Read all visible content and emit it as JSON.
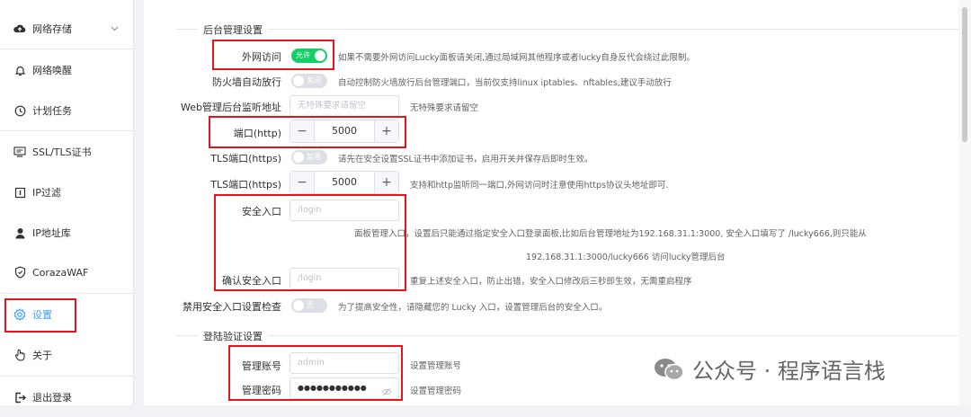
{
  "sidebar": {
    "items": [
      {
        "label": "网络存储",
        "icon": "cloud-icon"
      },
      {
        "label": "网络唤醒",
        "icon": "bell-icon"
      },
      {
        "label": "计划任务",
        "icon": "clock-icon"
      },
      {
        "label": "SSL/TLS证书",
        "icon": "certificate-icon"
      },
      {
        "label": "IP过滤",
        "icon": "filter-icon"
      },
      {
        "label": "IP地址库",
        "icon": "user-icon"
      },
      {
        "label": "CorazaWAF",
        "icon": "shield-icon"
      },
      {
        "label": "设置",
        "icon": "gear-icon"
      },
      {
        "label": "关于",
        "icon": "pointer-icon"
      },
      {
        "label": "退出登录",
        "icon": "logout-icon"
      }
    ],
    "active": "设置"
  },
  "backend": {
    "section_title": "后台管理设置",
    "wan_access": {
      "label": "外网访问",
      "switch": "允许",
      "hint": "如果不需要外网访问Lucky面板请关闭,通过局域网其他程序或者lucky自身反代会绕过此限制。"
    },
    "firewall": {
      "label": "防火墙自动放行",
      "switch": "关闭",
      "hint": "自动控制防火墙放行后台管理端口，当前仅支持linux iptables、nftables,建议手动放行"
    },
    "web_listen": {
      "label": "Web管理后台监听地址",
      "placeholder": "无特殊要求请留空",
      "hint": "无特殊要求请留空"
    },
    "http_port": {
      "label": "端口(http)",
      "value": "5000",
      "minus": "−",
      "plus": "+"
    },
    "tls_port_switch": {
      "label": "TLS端口(https)",
      "switch": "禁用",
      "hint": "请先在安全设置SSL证书中添加证书，启用开关并保存后即时生效。"
    },
    "tls_port": {
      "label": "TLS端口(https)",
      "value": "5000",
      "minus": "−",
      "plus": "+",
      "hint": "支持和http监听同一端口,外网访问时注意使用https协议头地址即可."
    },
    "safe_entry": {
      "label": "安全入口",
      "placeholder": "/login",
      "hint_line1": "面板管理入口，设置后只能通过指定安全入口登录面板,比如后台管理地址为192.168.31.1:3000, 安全入口填写了 /lucky666,则只能从",
      "hint_line2": "192.168.31.1:3000/lucky666 访问lucky管理后台"
    },
    "confirm_entry": {
      "label": "确认安全入口",
      "placeholder": "/login",
      "hint": "重复上述安全入口，防止出错，安全入口修改后三秒即生效，无需重启程序"
    },
    "disable_check": {
      "label": "禁用安全入口设置检查",
      "switch": "否",
      "hint": "为了提高安全性，请隐藏您的 Lucky 入口，设置管理后台的安全入口。"
    }
  },
  "login": {
    "section_title": "登陆验证设置",
    "account": {
      "label": "管理账号",
      "value": "admin",
      "hint": "设置管理账号"
    },
    "password": {
      "label": "管理密码",
      "value": "●●●●●●●●●●●",
      "hint": "设置管理密码"
    }
  },
  "watermark": {
    "text": "公众号 · 程序语言栈"
  },
  "colors": {
    "red_highlight": "#e3151b",
    "switch_on": "#13ce66",
    "active": "#409eff"
  }
}
